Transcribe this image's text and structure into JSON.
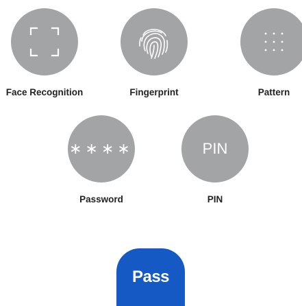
{
  "options": [
    {
      "label": "Face Recognition",
      "icon": "face-frame-icon"
    },
    {
      "label": "Fingerprint",
      "icon": "fingerprint-icon"
    },
    {
      "label": "Pattern",
      "icon": "pattern-dots-icon"
    },
    {
      "label": "Password",
      "icon": "password-asterisks-icon",
      "glyph": "∗∗∗∗"
    },
    {
      "label": "PIN",
      "icon": "pin-text-icon",
      "glyph": "PIN"
    }
  ],
  "pass": {
    "label": "Pass",
    "icon": "samsung-pass-logo"
  },
  "colors": {
    "circle": "#a3a4a6",
    "pass_blue": "#1459c4",
    "label": "#222222",
    "background": "#ffffff"
  }
}
